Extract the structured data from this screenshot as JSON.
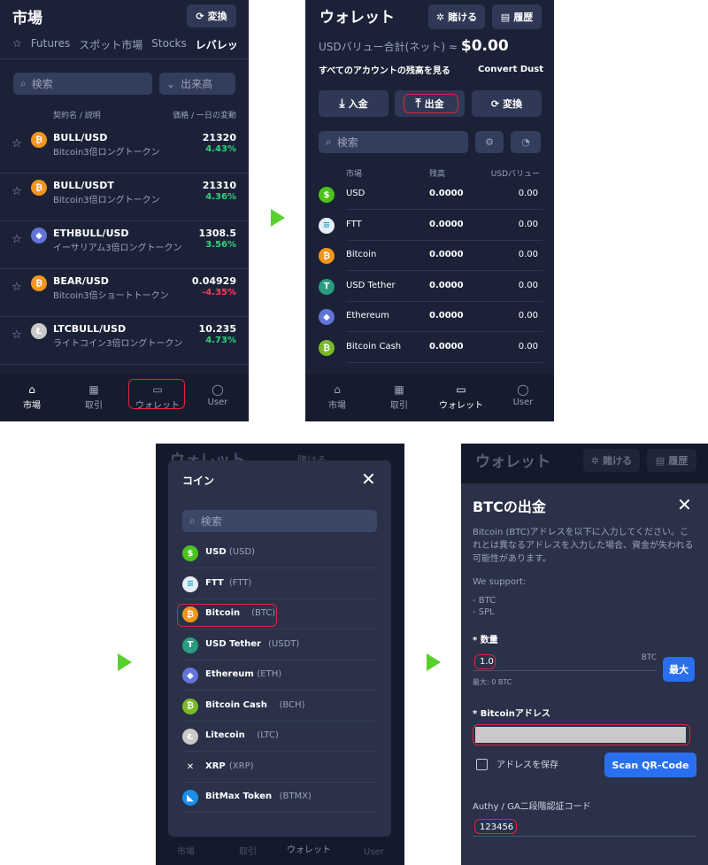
{
  "p1": {
    "title": "市場",
    "convert_label": "変換",
    "tabs": [
      "Futures",
      "スポット市場",
      "Stocks",
      "レバレッ"
    ],
    "search_placeholder": "検索",
    "volume_label": "出来高",
    "col_name": "契約名 / 説明",
    "col_price": "価格 / 一日の変動",
    "rows": [
      {
        "pair": "BULL/USD",
        "desc": "Bitcoin3倍ロングトークン",
        "price": "21320",
        "change": "4.43%"
      },
      {
        "pair": "BULL/USDT",
        "desc": "Bitcoin3倍ロングトークン",
        "price": "21310",
        "change": "4.36%"
      },
      {
        "pair": "ETHBULL/USD",
        "desc": "イーサリアム3倍ロングトークン",
        "price": "1308.5",
        "change": "3.56%"
      },
      {
        "pair": "BEAR/USD",
        "desc": "Bitcoin3倍ショートトークン",
        "price": "0.04929",
        "change": "-4.35%"
      },
      {
        "pair": "LTCBULL/USD",
        "desc": "ライトコイン3倍ロングトークン",
        "price": "10.235",
        "change": "4.73%"
      }
    ],
    "nav": [
      "市場",
      "取引",
      "ウォレット",
      "User"
    ]
  },
  "p2": {
    "title": "ウォレット",
    "bet_label": "賭ける",
    "history_label": "履歴",
    "usd_label": "USDバリュー合計(ネット) ≈",
    "usd_value": "$0.00",
    "all_accounts": "すべてのアカウントの残高を見る",
    "convert_dust": "Convert Dust",
    "deposit": "入金",
    "withdraw": "出金",
    "convert": "変換",
    "search_placeholder": "検索",
    "col_market": "市場",
    "col_balance": "残高",
    "col_usd": "USDバリュー",
    "rows": [
      {
        "name": "USD",
        "bal": "0.0000",
        "usd": "0.00"
      },
      {
        "name": "FTT",
        "bal": "0.0000",
        "usd": "0.00"
      },
      {
        "name": "Bitcoin",
        "bal": "0.0000",
        "usd": "0.00"
      },
      {
        "name": "USD Tether",
        "bal": "0.0000",
        "usd": "0.00"
      },
      {
        "name": "Ethereum",
        "bal": "0.0000",
        "usd": "0.00"
      },
      {
        "name": "Bitcoin Cash",
        "bal": "0.0000",
        "usd": "0.00"
      }
    ],
    "nav": [
      "市場",
      "取引",
      "ウォレット",
      "User"
    ]
  },
  "p3": {
    "bg_title": "ウォレット",
    "bg_bet": "賭ける",
    "title": "コイン",
    "search_placeholder": "検索",
    "coins": [
      {
        "name": "USD",
        "code": "(USD)"
      },
      {
        "name": "FTT",
        "code": "(FTT)"
      },
      {
        "name": "Bitcoin",
        "code": "(BTC)"
      },
      {
        "name": "USD Tether",
        "code": "(USDT)"
      },
      {
        "name": "Ethereum",
        "code": "(ETH)"
      },
      {
        "name": "Bitcoin Cash",
        "code": "(BCH)"
      },
      {
        "name": "Litecoin",
        "code": "(LTC)"
      },
      {
        "name": "XRP",
        "code": "(XRP)"
      },
      {
        "name": "BitMax Token",
        "code": "(BTMX)"
      }
    ],
    "nav": [
      "市場",
      "取引",
      "ウォレット",
      "User"
    ]
  },
  "p4": {
    "bg_title": "ウォレット",
    "bg_bet": "賭ける",
    "bg_history": "履歴",
    "title": "BTCの出金",
    "desc": "Bitcoin (BTC)アドレスを以下に入力してください。これとは異なるアドレスを入力した場合、資金が失われる可能性があります。",
    "support": "We support:",
    "support_1": "- BTC",
    "support_2": "- SPL",
    "qty_label": "* 数量",
    "qty_value": "1.0",
    "qty_unit": "BTC",
    "max_label": "最大",
    "max_info": "最大: 0 BTC",
    "addr_label": "* Bitcoinアドレス",
    "save_addr": "アドレスを保存",
    "scan_qr": "Scan QR-Code",
    "twofa_label": "Authy / GA二段階認証コード",
    "twofa_value": "123456"
  }
}
